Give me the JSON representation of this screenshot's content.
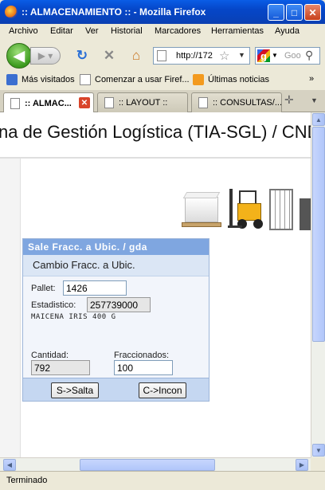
{
  "window": {
    "title": ":: ALMACENAMIENTO :: - Mozilla Firefox"
  },
  "menu": [
    "Archivo",
    "Editar",
    "Ver",
    "Historial",
    "Marcadores",
    "Herramientas",
    "Ayuda"
  ],
  "nav": {
    "url": "http://172",
    "search_placeholder": "Goo"
  },
  "bookmarks": [
    "Más visitados",
    "Comenzar a usar Firef...",
    "Últimas noticias",
    "»"
  ],
  "tabs": [
    ":: ALMAC...",
    ":: LAYOUT ::",
    ":: CONSULTAS/..."
  ],
  "page": {
    "system_title": "na de Gestión Logística (TIA-SGL) / CND"
  },
  "form": {
    "header": "Sale Fracc. a Ubic. / gda",
    "subheader": "Cambio Fracc. a Ubic.",
    "pallet_label": "Pallet:",
    "pallet_value": "1426",
    "estadistico_label": "Estadistico:",
    "estadistico_value": "257739000",
    "description": "MAICENA IRIS 400 G",
    "cantidad_label": "Cantidad:",
    "cantidad_value": "792",
    "fraccionados_label": "Fraccionados:",
    "fraccionados_value": "100",
    "btn_salta": "S->Salta",
    "btn_incon": "C->Incon"
  },
  "status": {
    "text": "Terminado"
  }
}
